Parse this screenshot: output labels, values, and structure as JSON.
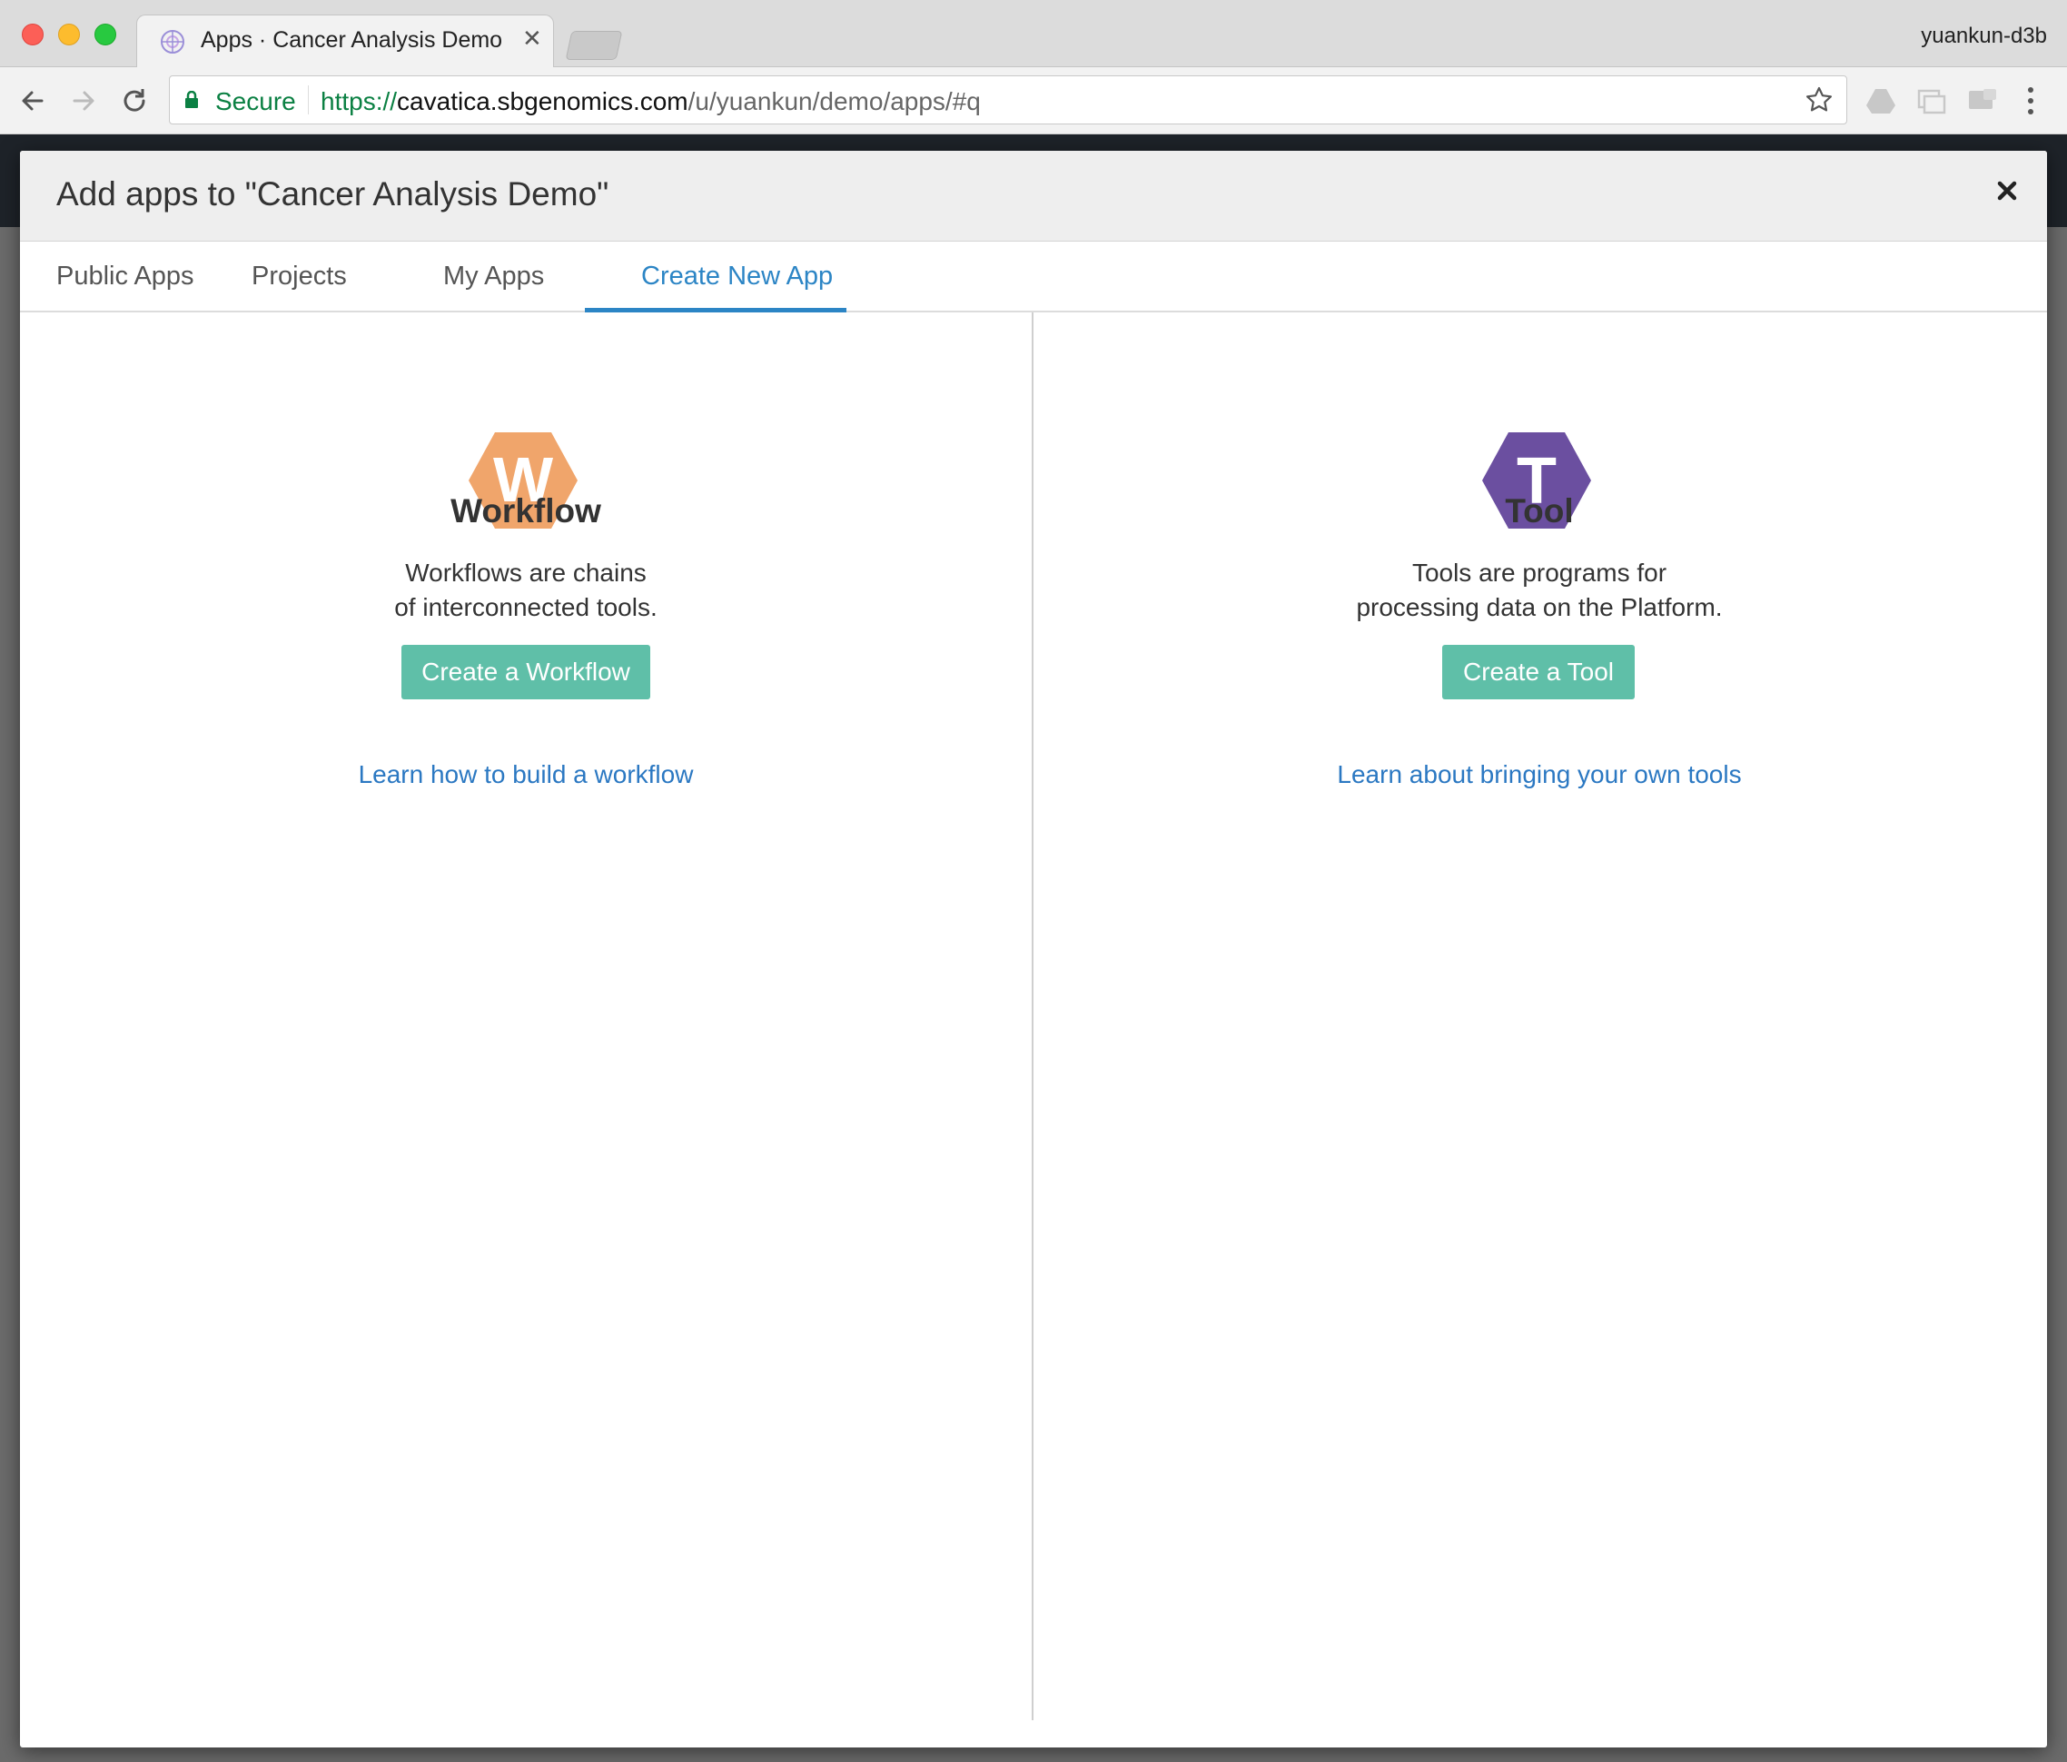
{
  "browser": {
    "tab_title": "Apps · Cancer Analysis Demo",
    "profile_name": "yuankun-d3b",
    "secure_label": "Secure",
    "url_scheme": "https://",
    "url_host": "cavatica.sbgenomics.com",
    "url_path": "/u/yuankun/demo/apps/#q"
  },
  "modal": {
    "title": "Add apps to \"Cancer Analysis Demo\"",
    "tabs": [
      {
        "label": "Public Apps",
        "active": false
      },
      {
        "label": "Projects",
        "active": false
      },
      {
        "label": "My Apps",
        "active": false
      },
      {
        "label": "Create New App",
        "active": true
      }
    ],
    "workflow": {
      "icon_letter": "W",
      "icon_color": "#f0a56b",
      "title": "Workflow",
      "desc_line1": "Workflows are chains",
      "desc_line2": "of interconnected tools.",
      "button": "Create a Workflow",
      "link": "Learn how to build a workflow"
    },
    "tool": {
      "icon_letter": "T",
      "icon_color": "#6b4fa0",
      "title": "Tool",
      "desc_line1": "Tools are programs for",
      "desc_line2": "processing data on the Platform.",
      "button": "Create a Tool",
      "link": "Learn about bringing your own tools"
    }
  },
  "colors": {
    "accent": "#2c85c5",
    "button": "#5fbfa8",
    "link": "#2b78c2"
  }
}
